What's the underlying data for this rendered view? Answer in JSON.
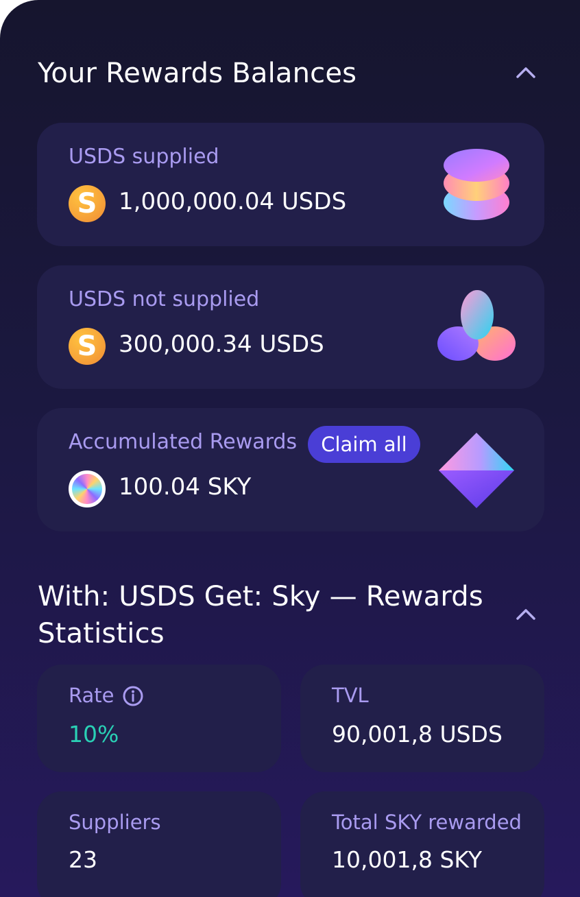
{
  "balances": {
    "title": "Your Rewards Balances",
    "supplied": {
      "label": "USDS supplied",
      "value": "1,000,000.04 USDS",
      "token_icon": "usds-token-icon"
    },
    "not_supplied": {
      "label": "USDS not supplied",
      "value": "300,000.34 USDS",
      "token_icon": "usds-token-icon"
    },
    "accumulated": {
      "label": "Accumulated Rewards",
      "claim_label": "Claim all",
      "value": "100.04 SKY",
      "token_icon": "sky-token-icon"
    }
  },
  "stats": {
    "title_line1": "With: USDS Get: Sky — Rewards",
    "title_line2": "Statistics",
    "rate": {
      "label": "Rate",
      "value": "10%"
    },
    "tvl": {
      "label": "TVL",
      "value": "90,001,8 USDS"
    },
    "suppliers": {
      "label": "Suppliers",
      "value": "23"
    },
    "total_rewarded": {
      "label": "Total SKY rewarded",
      "value": "10,001,8 SKY"
    }
  },
  "colors": {
    "accent": "#4a3ed6",
    "label": "#a99bf0",
    "positive": "#2ad0b5",
    "card": "#221f4a"
  }
}
